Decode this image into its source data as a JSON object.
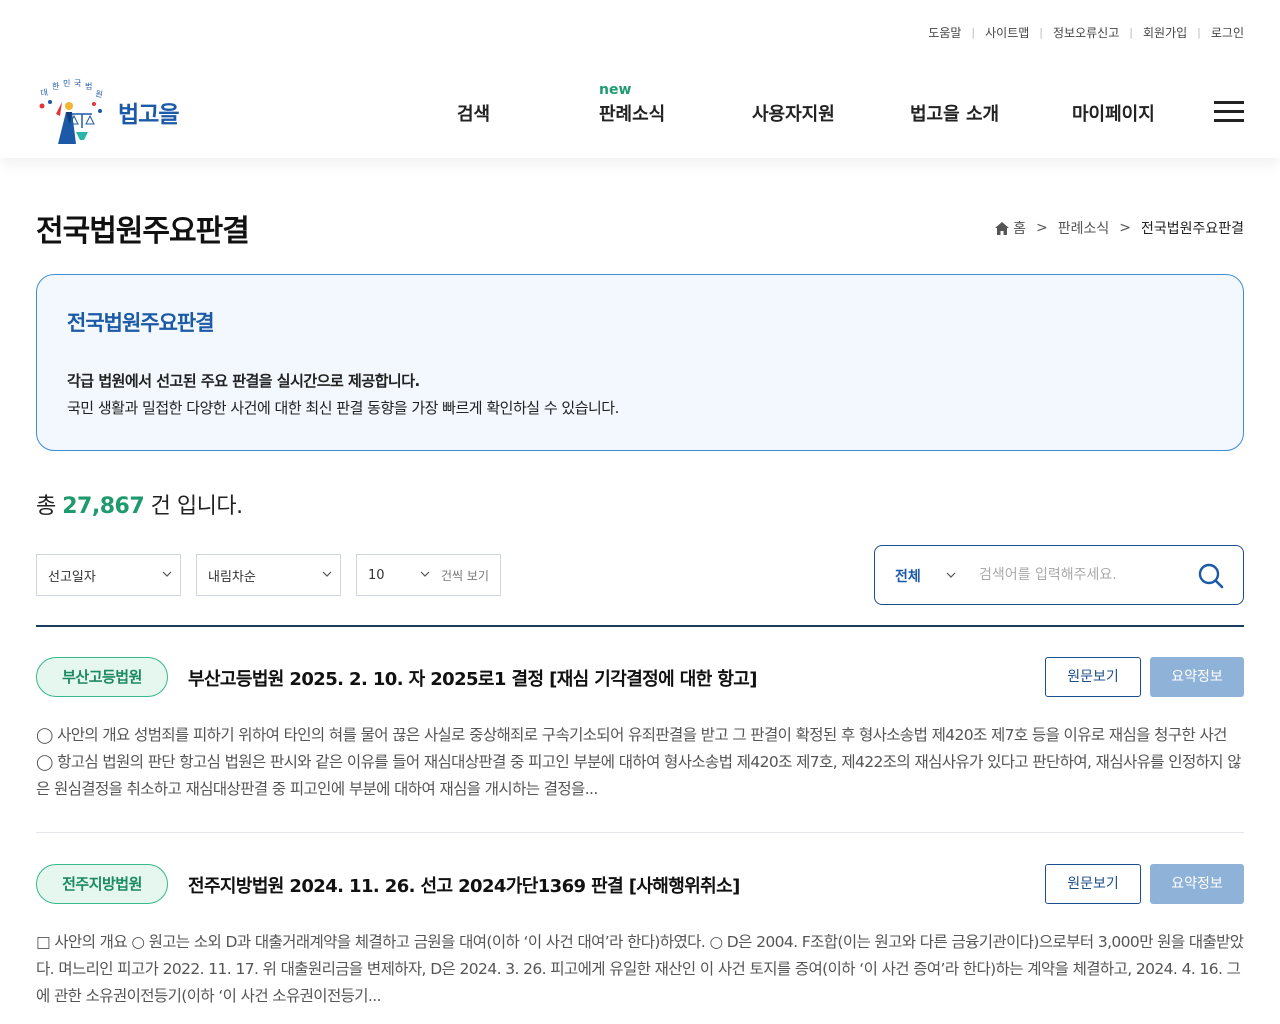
{
  "util_links": [
    "도움말",
    "사이트맵",
    "정보오류신고",
    "회원가입",
    "로그인"
  ],
  "logo": {
    "seal_text": "대한민국법원",
    "name": "법고을"
  },
  "nav": {
    "items": [
      "검색",
      "판례소식",
      "사용자지원",
      "법고을 소개",
      "마이페이지"
    ],
    "new_badge": "new"
  },
  "page": {
    "title": "전국법원주요판결"
  },
  "breadcrumb": {
    "home": "홈",
    "section": "판례소식",
    "current": "전국법원주요판결"
  },
  "info": {
    "title": "전국법원주요판결",
    "line1": "각급 법원에서 선고된 주요 판결을 실시간으로 제공합니다.",
    "line2": "국민 생활과 밀접한 다양한 사건에 대한 최신 판결 동향을 가장 빠르게 확인하실 수 있습니다."
  },
  "total": {
    "prefix": "총",
    "count": "27,867",
    "suffix": "건 입니다."
  },
  "filters": {
    "sort_field": "선고일자",
    "sort_order": "내림차순",
    "page_size": "10",
    "page_size_suffix": "건씩 보기"
  },
  "search": {
    "scope": "전체",
    "placeholder": "검색어를 입력해주세요.",
    "value": ""
  },
  "results": [
    {
      "court": "부산고등법원",
      "title": "부산고등법원 2025. 2. 10. 자 2025로1 결정 [재심 기각결정에 대한 항고]",
      "btn_original": "원문보기",
      "btn_summary": "요약정보",
      "summary": "◯ 사안의 개요 성범죄를 피하기 위하여 타인의 혀를 물어 끊은 사실로 중상해죄로 구속기소되어 유죄판결을 받고 그 판결이 확정된 후 형사소송법 제420조 제7호 등을 이유로 재심을 청구한 사건  ◯ 항고심 법원의 판단 항고심 법원은 판시와 같은 이유를 들어 재심대상판결 중 피고인 부분에 대하여 형사소송법 제420조 제7호, 제422조의 재심사유가 있다고 판단하여, 재심사유를 인정하지 않은 원심결정을 취소하고 재심대상판결 중 피고인에 부분에 대하여 재심을 개시하는 결정을..."
    },
    {
      "court": "전주지방법원",
      "title": "전주지방법원 2024. 11. 26. 선고 2024가단1369 판결 [사해행위취소]",
      "btn_original": "원문보기",
      "btn_summary": "요약정보",
      "summary": "□ 사안의 개요 ○ 원고는 소외 D과 대출거래계약을 체결하고 금원을 대여(이하 ‘이 사건 대여’라 한다)하였다. ○ D은 2004. F조합(이는 원고와 다른 금융기관이다)으로부터 3,000만 원을 대출받았다. 며느리인 피고가 2022. 11. 17. 위 대출원리금을 변제하자, D은 2024. 3. 26. 피고에게 유일한 재산인 이 사건 토지를 증여(이하 ‘이 사건 증여’라 한다)하는 계약을 체결하고, 2024. 4. 16. 그에 관한 소유권이전등기(이하 ‘이 사건 소유권이전등기..."
    }
  ],
  "colors": {
    "brand_blue": "#1c5aa8",
    "accent_green": "#1f9a6e",
    "summary_button": "#8fb2d9"
  }
}
